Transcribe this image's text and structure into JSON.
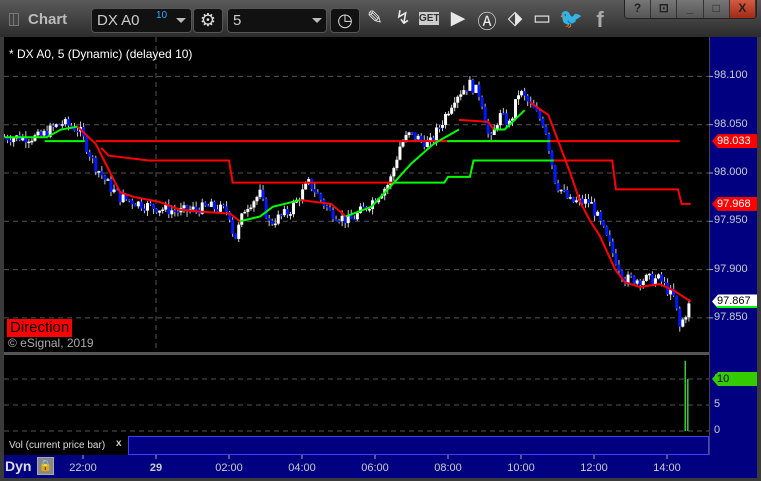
{
  "window": {
    "title": "Chart",
    "help": "?",
    "min": "_",
    "max": "□",
    "close": "X"
  },
  "toolbar": {
    "symbol": "DX A0",
    "symbol_badge": "10",
    "interval": "5",
    "icons": [
      "pencil-icon",
      "line-tool-icon",
      "get-icon",
      "play-icon",
      "alert-icon",
      "link-icon",
      "comment-icon",
      "twitter-icon",
      "facebook-icon"
    ]
  },
  "chart": {
    "legend": "* DX A0, 5 (Dynamic) (delayed 10)",
    "direction_label": "Direction",
    "copyright": "© eSignal, 2019",
    "volume_label": "Vol (current price bar)",
    "volume_close": "x",
    "mode": "Dyn"
  },
  "colors": {
    "up": "#ffffff",
    "down": "#0018ff",
    "red": "#ff0000",
    "green": "#00ff00",
    "axis": "#000080"
  },
  "chart_data": [
    {
      "type": "candlestick",
      "title": "DX A0, 5 (Dynamic) (delayed 10)",
      "bar_minutes": 5,
      "x_unit": "hours from 29 00:00",
      "x_ticks": [
        {
          "h": -2,
          "label": "22:00"
        },
        {
          "h": 0,
          "label": "29"
        },
        {
          "h": 2,
          "label": "02:00"
        },
        {
          "h": 4,
          "label": "04:00"
        },
        {
          "h": 6,
          "label": "06:00"
        },
        {
          "h": 8,
          "label": "08:00"
        },
        {
          "h": 10,
          "label": "10:00"
        },
        {
          "h": 12,
          "label": "12:00"
        },
        {
          "h": 14,
          "label": "14:00"
        }
      ],
      "y_ticks": [
        "98.100",
        "98.050",
        "98.000",
        "97.950",
        "97.900",
        "97.850"
      ],
      "ylim": [
        97.82,
        98.135
      ],
      "close_path": [
        [
          -4.15,
          98.037
        ],
        [
          -3.2,
          98.037
        ],
        [
          -2.6,
          98.052
        ],
        [
          -2.1,
          98.045
        ],
        [
          -1.7,
          98.01
        ],
        [
          -1.25,
          97.985
        ],
        [
          -1.0,
          97.975
        ],
        [
          -0.15,
          97.965
        ],
        [
          0.65,
          97.96
        ],
        [
          1.5,
          97.965
        ],
        [
          2.0,
          97.96
        ],
        [
          2.15,
          97.93
        ],
        [
          2.45,
          97.965
        ],
        [
          2.85,
          97.978
        ],
        [
          3.1,
          97.948
        ],
        [
          3.65,
          97.96
        ],
        [
          4.2,
          97.99
        ],
        [
          4.75,
          97.96
        ],
        [
          5.3,
          97.95
        ],
        [
          5.85,
          97.968
        ],
        [
          6.4,
          97.99
        ],
        [
          6.7,
          98.03
        ],
        [
          6.95,
          98.04
        ],
        [
          7.5,
          98.03
        ],
        [
          7.8,
          98.05
        ],
        [
          8.2,
          98.08
        ],
        [
          8.6,
          98.092
        ],
        [
          8.9,
          98.08
        ],
        [
          9.15,
          98.03
        ],
        [
          9.4,
          98.06
        ],
        [
          9.7,
          98.05
        ],
        [
          9.95,
          98.085
        ],
        [
          10.25,
          98.07
        ],
        [
          10.65,
          98.05
        ],
        [
          10.95,
          97.99
        ],
        [
          11.35,
          97.97
        ],
        [
          11.9,
          97.97
        ],
        [
          12.15,
          97.95
        ],
        [
          12.6,
          97.91
        ],
        [
          12.85,
          97.89
        ],
        [
          13.25,
          97.89
        ],
        [
          13.8,
          97.89
        ],
        [
          14.2,
          97.87
        ],
        [
          14.35,
          97.84
        ],
        [
          14.65,
          97.867
        ]
      ],
      "lines": [
        {
          "name": "level",
          "color": "#ff0000",
          "points": [
            [
              -1.65,
              98.033
            ],
            [
              14.35,
              98.033
            ]
          ]
        },
        {
          "name": "level-green-1",
          "color": "#00ff00",
          "points": [
            [
              -3.05,
              98.033
            ],
            [
              -1.95,
              98.033
            ]
          ]
        },
        {
          "name": "level-green-2",
          "color": "#00ff00",
          "points": [
            [
              7.98,
              98.033
            ],
            [
              10.8,
              98.033
            ]
          ]
        },
        {
          "name": "stop",
          "color": "#ff0000",
          "points": [
            [
              -1.5,
              98.026
            ],
            [
              -1.3,
              98.018
            ],
            [
              -0.2,
              98.013
            ],
            [
              2.0,
              98.013
            ],
            [
              2.1,
              97.99
            ],
            [
              6.5,
              97.99
            ]
          ]
        },
        {
          "name": "stop-green",
          "color": "#00ff00",
          "points": [
            [
              6.5,
              97.99
            ],
            [
              7.9,
              97.99
            ],
            [
              8.0,
              97.996
            ],
            [
              8.6,
              97.996
            ],
            [
              8.7,
              98.013
            ],
            [
              10.9,
              98.013
            ]
          ]
        },
        {
          "name": "stop-red",
          "color": "#ff0000",
          "points": [
            [
              10.9,
              98.013
            ],
            [
              12.5,
              98.013
            ],
            [
              12.6,
              97.983
            ],
            [
              14.3,
              97.983
            ],
            [
              14.4,
              97.968
            ],
            [
              14.65,
              97.968
            ]
          ]
        },
        {
          "name": "ma-green",
          "color": "#00ff00",
          "points": [
            [
              -4.15,
              98.037
            ],
            [
              -3.0,
              98.037
            ],
            [
              -2.6,
              98.045
            ],
            [
              -2.15,
              98.048
            ]
          ]
        },
        {
          "name": "ma-red",
          "color": "#ff0000",
          "points": [
            [
              -2.15,
              98.048
            ],
            [
              -1.65,
              98.03
            ],
            [
              -1.25,
              98.0
            ],
            [
              -0.98,
              97.98
            ],
            [
              -0.58,
              97.975
            ],
            [
              0.1,
              97.97
            ],
            [
              0.66,
              97.962
            ],
            [
              1.2,
              97.96
            ],
            [
              2.03,
              97.958
            ],
            [
              2.3,
              97.95
            ]
          ]
        },
        {
          "name": "ma-green-2",
          "color": "#00ff00",
          "points": [
            [
              2.3,
              97.95
            ],
            [
              2.85,
              97.955
            ],
            [
              3.2,
              97.965
            ],
            [
              3.95,
              97.972
            ]
          ]
        },
        {
          "name": "ma-red-2",
          "color": "#ff0000",
          "points": [
            [
              3.95,
              97.972
            ],
            [
              4.8,
              97.968
            ],
            [
              5.2,
              97.955
            ]
          ]
        },
        {
          "name": "ma-green-3",
          "color": "#00ff00",
          "points": [
            [
              5.2,
              97.955
            ],
            [
              5.9,
              97.965
            ],
            [
              6.4,
              97.985
            ],
            [
              7.0,
              98.01
            ],
            [
              7.6,
              98.03
            ],
            [
              8.3,
              98.045
            ]
          ]
        },
        {
          "name": "ma-red-3",
          "color": "#ff0000",
          "points": [
            [
              8.3,
              98.055
            ],
            [
              9.1,
              98.053
            ],
            [
              9.25,
              98.045
            ]
          ]
        },
        {
          "name": "ma-green-4",
          "color": "#00ff00",
          "points": [
            [
              9.25,
              98.045
            ],
            [
              9.55,
              98.045
            ],
            [
              10.1,
              98.065
            ]
          ]
        },
        {
          "name": "ma-red-4",
          "color": "#ff0000",
          "points": [
            [
              10.25,
              98.073
            ],
            [
              10.75,
              98.06
            ],
            [
              11.05,
              98.03
            ],
            [
              11.35,
              98.0
            ],
            [
              11.62,
              97.97
            ],
            [
              11.9,
              97.95
            ],
            [
              12.16,
              97.935
            ],
            [
              12.58,
              97.9
            ],
            [
              12.85,
              97.887
            ],
            [
              13.25,
              97.882
            ],
            [
              13.8,
              97.885
            ],
            [
              14.2,
              97.878
            ],
            [
              14.65,
              97.867
            ]
          ]
        }
      ],
      "price_markers": [
        {
          "value": "98.033",
          "color": "#ff0000"
        },
        {
          "value": "97.968",
          "color": "#ff0000"
        },
        {
          "value": "97.867",
          "color": "#ffffff"
        }
      ]
    },
    {
      "type": "bar",
      "title": "Vol (current price bar)",
      "x": [
        14.5,
        14.57
      ],
      "values": [
        13.5,
        10
      ],
      "y_ticks": [
        "10",
        "5",
        "0"
      ],
      "ylim": [
        0,
        15
      ],
      "last_value": "10"
    }
  ]
}
